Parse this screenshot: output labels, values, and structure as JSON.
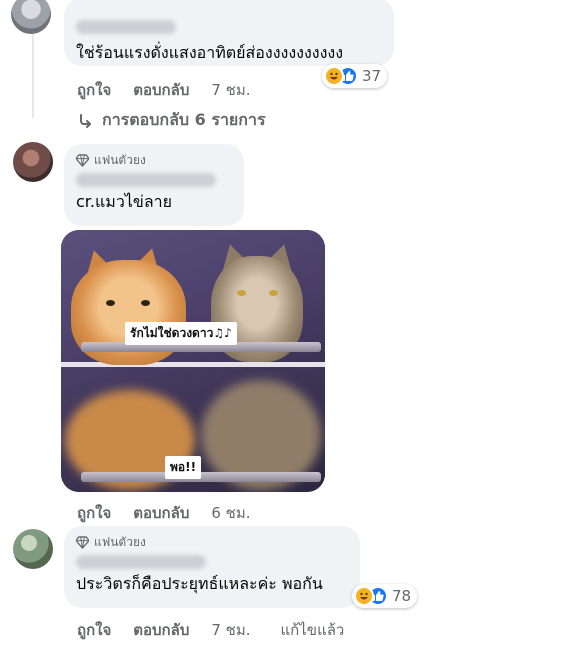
{
  "comments": [
    {
      "author_hidden": true,
      "text": "ใช่ร้อนแรงดั่งแสงอาทิตย์ส่องงงงงงงงงง",
      "actions": {
        "like": "ถูกใจ",
        "reply": "ตอบกลับ",
        "time": "7 ชม."
      },
      "reactions": {
        "types": [
          "haha",
          "like"
        ],
        "count": "37"
      },
      "replies_link": "การตอบกลับ 6 รายการ"
    },
    {
      "badge": "แฟนตัวยง",
      "author_hidden": true,
      "text": "cr.แมวไข่ลาย",
      "photo": {
        "caption_top": "รักไม่ใช่ดวงดาว♫♪",
        "caption_bottom": "พอ!!"
      },
      "actions": {
        "like": "ถูกใจ",
        "reply": "ตอบกลับ",
        "time": "6 ชม."
      }
    },
    {
      "badge": "แฟนตัวยง",
      "author_hidden": true,
      "text": "ประวิตรก็คือประยุทธ์แหละค่ะ พอกัน",
      "actions": {
        "like": "ถูกใจ",
        "reply": "ตอบกลับ",
        "time": "7 ชม.",
        "edited": "แก้ไขแล้ว"
      },
      "reactions": {
        "types": [
          "haha",
          "like"
        ],
        "count": "78"
      }
    }
  ],
  "colors": {
    "bubble": "#f0f2f5",
    "secondary_text": "#65676b",
    "like_blue": "#1877f2",
    "haha_yellow": "#f7b125"
  }
}
